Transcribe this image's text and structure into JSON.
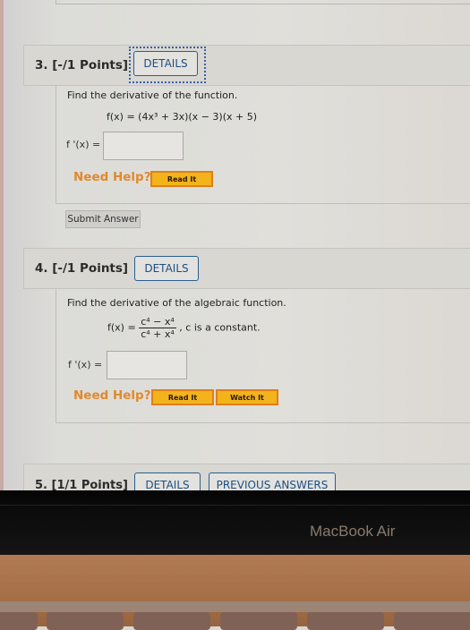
{
  "questions": [
    {
      "title": "3. [-/1 Points]",
      "details_label": "DETAILS",
      "prompt": "Find the derivative of the function.",
      "formula": "f(x) = (4x³ + 3x)(x − 3)(x + 5)",
      "answer_label": "f '(x) =",
      "answer_value": "",
      "need_help": "Need Help?",
      "help_buttons": [
        "Read It"
      ],
      "submit_label": "Submit Answer"
    },
    {
      "title": "4. [-/1 Points]",
      "details_label": "DETAILS",
      "prompt": "Find the derivative of the algebraic function.",
      "formula_lhs": "f(x) =",
      "formula_num": "c⁴ − x⁴",
      "formula_den": "c⁴ + x⁴",
      "formula_note": ",  c is a constant.",
      "answer_label": "f '(x) =",
      "answer_value": "",
      "need_help": "Need Help?",
      "help_buttons": [
        "Read It",
        "Watch It"
      ]
    },
    {
      "title": "5. [1/1 Points]",
      "details_label": "DETAILS",
      "previous_answers_label": "PREVIOUS ANSWERS"
    }
  ],
  "device": {
    "brand_label": "MacBook Air"
  },
  "colors": {
    "accent_blue": "#1e4f82",
    "help_orange": "#e0892e",
    "button_yellow": "#f2b31c"
  }
}
